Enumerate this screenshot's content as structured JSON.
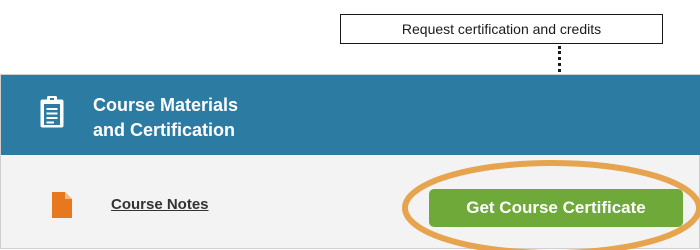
{
  "callout": {
    "text": "Request certification and credits"
  },
  "panel": {
    "title_line1": "Course Materials",
    "title_line2": "and Certification",
    "header_icon": "clipboard-icon"
  },
  "materials": {
    "notes_label": "Course Notes",
    "notes_icon": "document-icon",
    "certificate_button": "Get Course Certificate"
  },
  "colors": {
    "header": "#2c7ba3",
    "button": "#6ea93a",
    "highlight": "#e6a44e",
    "document_icon": "#e8781e"
  }
}
